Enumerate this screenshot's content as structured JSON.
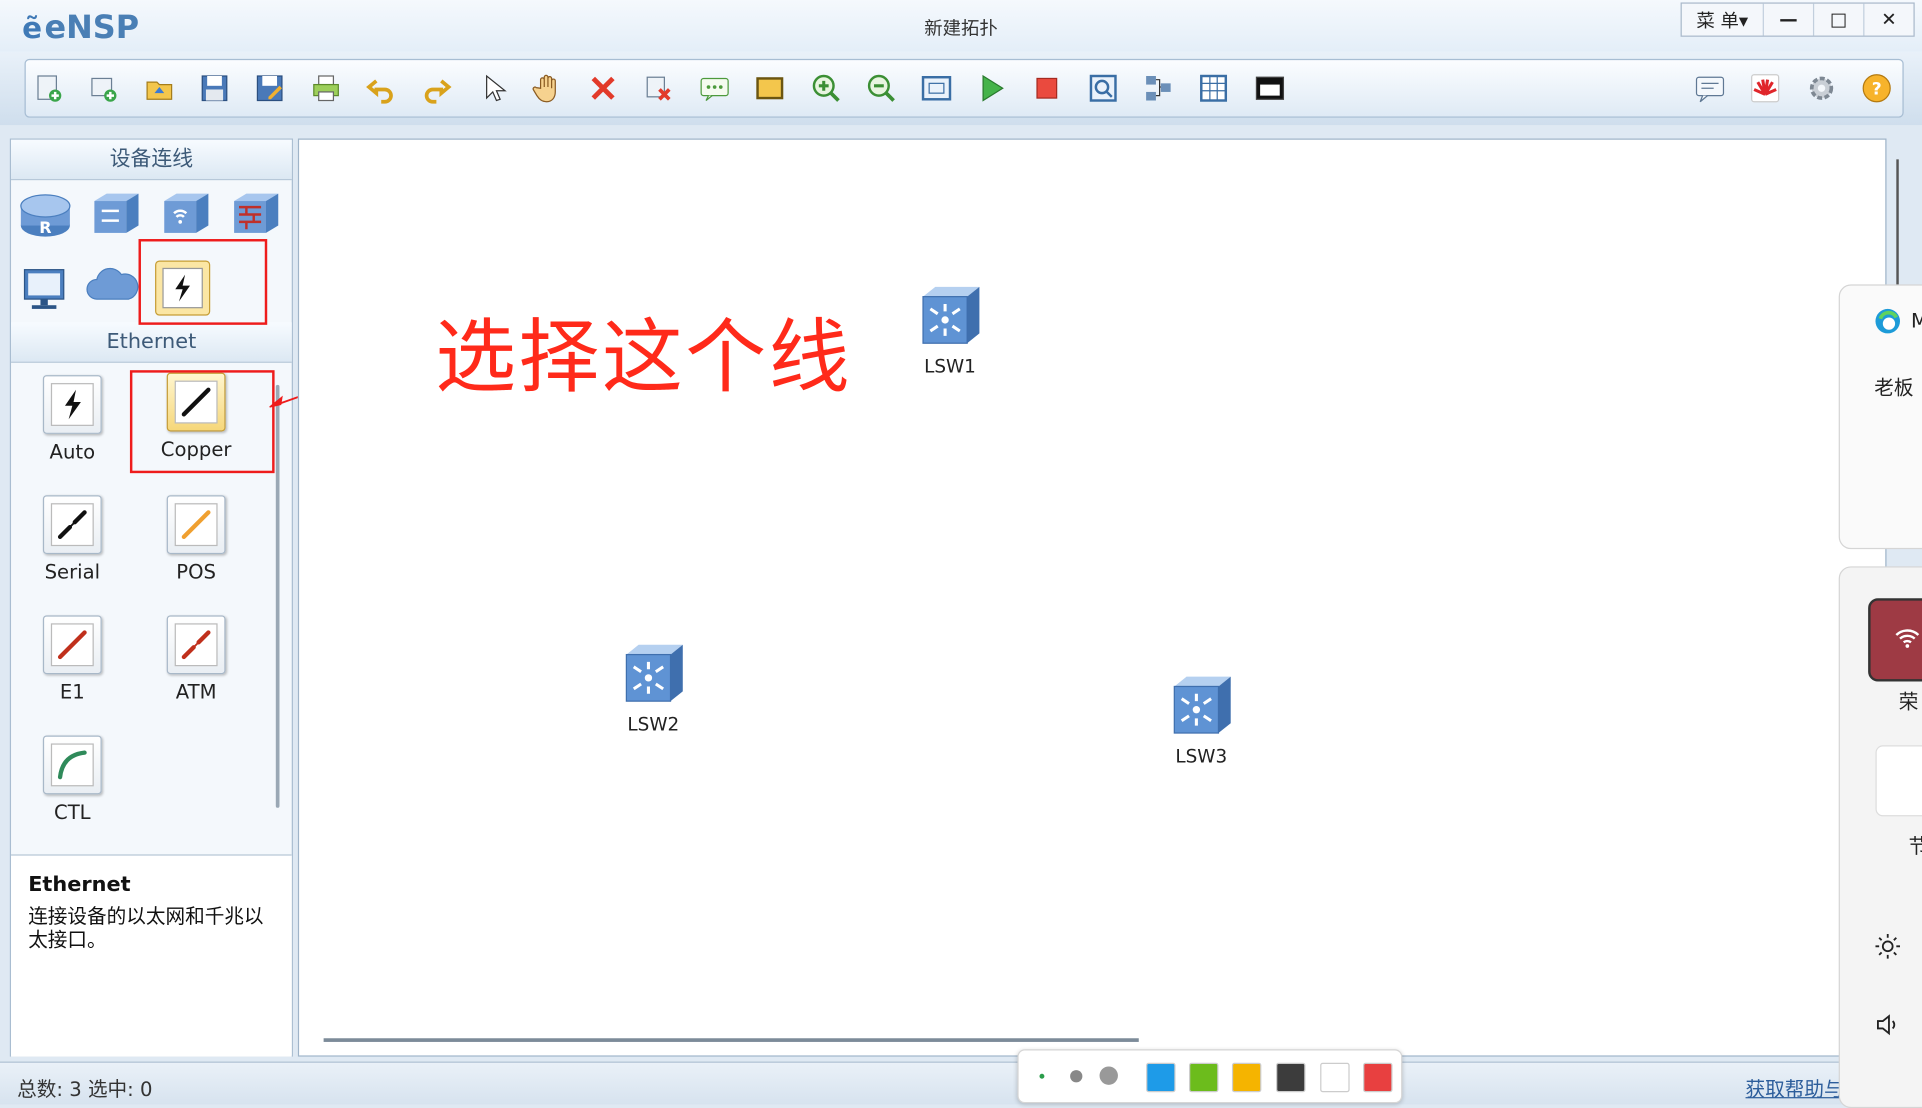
{
  "window": {
    "app_name": "eNSP",
    "title": "新建拓扑",
    "menu_label": "菜 单▾",
    "minimize_glyph": "—",
    "maximize_glyph": "□",
    "close_glyph": "✕"
  },
  "toolbar": {
    "buttons": [
      "new-topology",
      "new-device",
      "open",
      "save",
      "save-as",
      "print",
      "undo",
      "redo",
      "select",
      "pan",
      "delete",
      "delete-links",
      "text",
      "rectangle",
      "zoom-in",
      "zoom-out",
      "fit",
      "start",
      "stop",
      "capture",
      "topology",
      "grid",
      "console",
      "chat",
      "huawei",
      "settings",
      "help"
    ]
  },
  "left_panel": {
    "devices_title": "设备连线",
    "ethernet_title": "Ethernet",
    "cables": [
      {
        "label": "Auto",
        "color": "#111111",
        "selected": false
      },
      {
        "label": "Copper",
        "color": "#111111",
        "selected": true
      },
      {
        "label": "Serial",
        "color": "#111111",
        "selected": false
      },
      {
        "label": "POS",
        "color": "#f0a030",
        "selected": false
      },
      {
        "label": "E1",
        "color": "#c0301c",
        "selected": false
      },
      {
        "label": "ATM",
        "color": "#c0301c",
        "selected": false
      },
      {
        "label": "CTL",
        "color": "#2f8a5a",
        "selected": false
      }
    ],
    "desc_title": "Ethernet",
    "desc_text": "连接设备的以太网和千兆以太接口。"
  },
  "canvas": {
    "devices": [
      {
        "label": "LSW1"
      },
      {
        "label": "LSW2"
      },
      {
        "label": "LSW3"
      }
    ],
    "annotation": "选择这个线"
  },
  "status": {
    "left": "总数: 3 选中: 0",
    "right": "获取帮助与"
  },
  "palette": {
    "colors": [
      "#1e9be8",
      "#6cbc1c",
      "#f5b400",
      "#3c3c3c",
      "#ffffff",
      "#e84040"
    ]
  },
  "right_panel": {
    "browser_fragment": "M",
    "text1": "老板",
    "text2": "荣",
    "text3": "节"
  }
}
